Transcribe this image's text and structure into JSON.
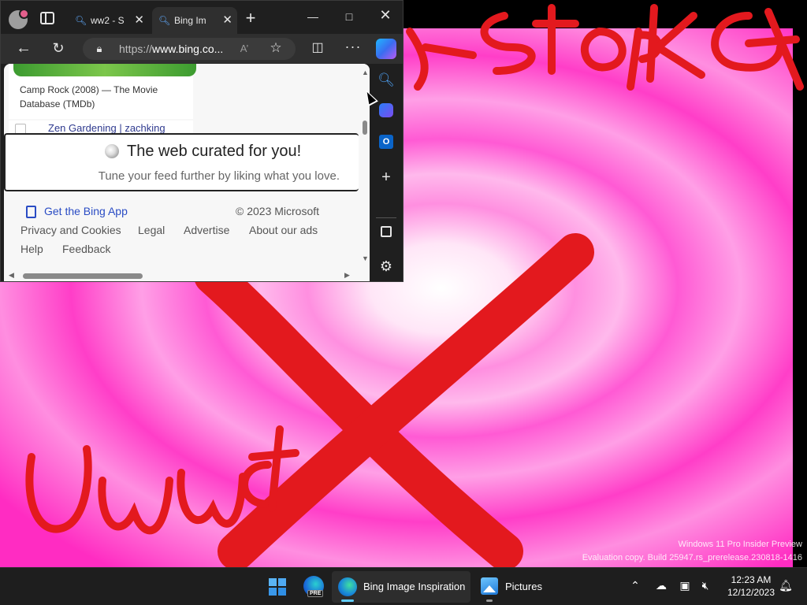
{
  "browser": {
    "tabs": [
      {
        "title": "ww2 - S",
        "active": false
      },
      {
        "title": "Bing Im",
        "active": true
      }
    ],
    "url_prefix": "https://",
    "url_domain": "www.bing.co...",
    "page": {
      "card1_title": "Camp Rock (2008) — The Movie Database (TMDb)",
      "card2_title": "Zen Gardening | zachking",
      "curated_title": "The web curated for you!",
      "curated_subtitle": "Tune your feed further by liking what you love.",
      "footer": {
        "get_app": "Get the Bing App",
        "copyright": "© 2023 Microsoft",
        "privacy": "Privacy and Cookies",
        "legal": "Legal",
        "advertise": "Advertise",
        "about_ads": "About our ads",
        "help": "Help",
        "feedback": "Feedback"
      }
    },
    "sidebar_icons": [
      "search-icon",
      "copilot-icon",
      "outlook-icon",
      "add-icon",
      "panel-icon",
      "settings-icon"
    ]
  },
  "desktop": {
    "watermark_line1": "Windows 11 Pro Insider Preview",
    "watermark_line2": "Evaluation copy. Build 25947.rs_prerelease.230818-1416",
    "drawing_text_top": "stop fcat",
    "drawing_text_bottom": "Uwu ct"
  },
  "taskbar": {
    "running_edge_label": "Bing Image Inspiration I",
    "pictures_label": "Pictures",
    "edge_pre_badge": "PRE",
    "time": "12:23 AM",
    "date": "12/12/2023"
  },
  "colors": {
    "wallpaper_pink": "#ff3ec8",
    "scribble_red": "#e3191e",
    "accent": "#60cdff"
  }
}
